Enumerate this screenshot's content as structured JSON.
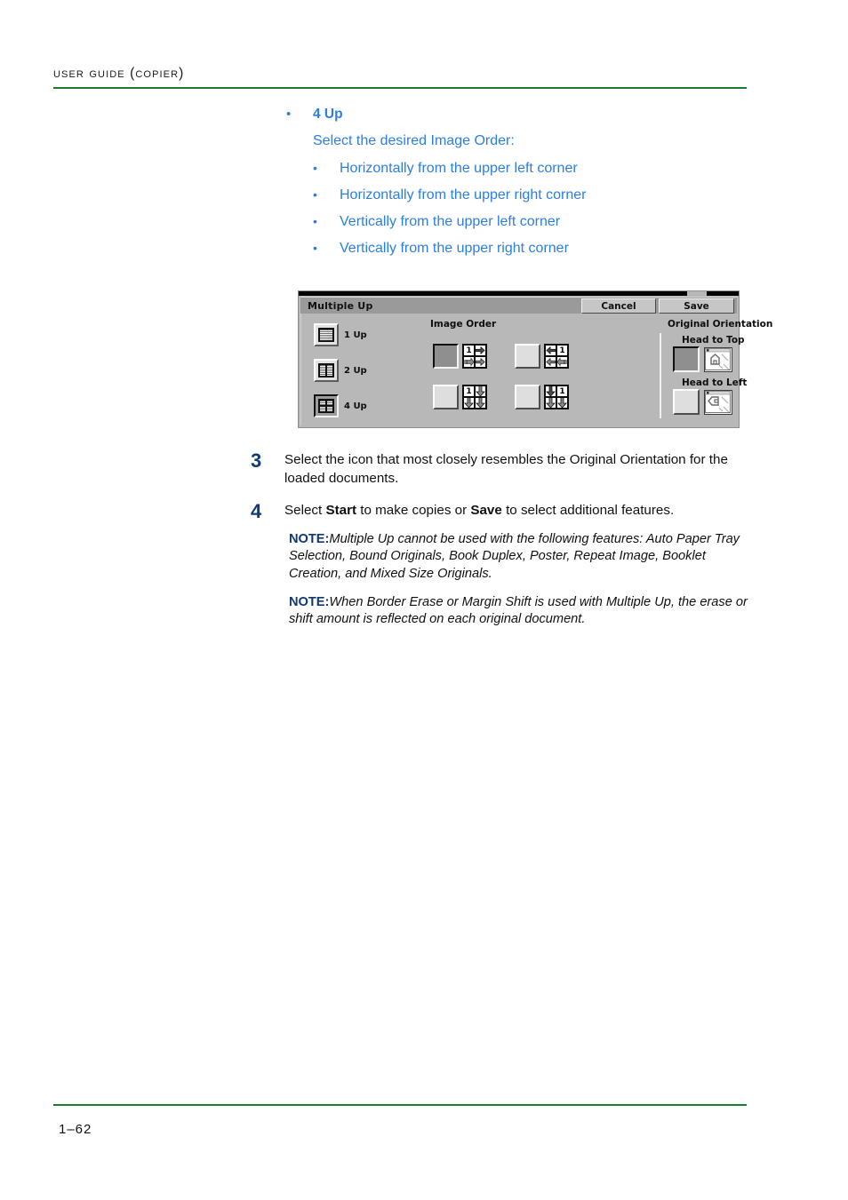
{
  "header": {
    "title": "User Guide (Copier)",
    "rule_color": "#1a7a2e"
  },
  "blue_section": {
    "accent_color": "#2c7fe0",
    "bullet_glyph": "•",
    "heading": "4 Up",
    "lead": "Select the desired Image Order:",
    "options": [
      "Horizontally from the upper left corner",
      "Horizontally from the upper right corner",
      "Vertically from the upper left corner",
      "Vertically from the upper right corner"
    ]
  },
  "copier_ui": {
    "title": "Multiple Up",
    "buttons": {
      "cancel": "Cancel",
      "save": "Save"
    },
    "up_options": [
      {
        "label": "1 Up",
        "selected": false
      },
      {
        "label": "2 Up",
        "selected": false
      },
      {
        "label": "4 Up",
        "selected": true
      }
    ],
    "image_order": {
      "heading": "Image Order",
      "cells": [
        {
          "name": "horizontal-upper-left",
          "selected": true,
          "digit": "1",
          "digit_corner": "top-left"
        },
        {
          "name": "horizontal-upper-right",
          "selected": false,
          "digit": "1",
          "digit_corner": "top-right"
        },
        {
          "name": "vertical-upper-left",
          "selected": false,
          "digit": "1",
          "digit_corner": "top-left"
        },
        {
          "name": "vertical-upper-right",
          "selected": false,
          "digit": "1",
          "digit_corner": "top-right"
        }
      ]
    },
    "original_orientation": {
      "heading": "Original Orientation",
      "options": [
        {
          "label": "Head to Top",
          "selected": true
        },
        {
          "label": "Head to Left",
          "selected": false
        }
      ]
    }
  },
  "steps": [
    {
      "number": "3",
      "text_before": "Select the icon that most closely resembles the Original Orientation for the loaded documents.",
      "bold_1": "",
      "text_mid": "",
      "bold_2": "",
      "text_after": ""
    },
    {
      "number": "4",
      "text_before": "Select ",
      "bold_1": "Start",
      "text_mid": " to make copies or ",
      "bold_2": "Save",
      "text_after": " to select additional features."
    }
  ],
  "notes": [
    {
      "label": "NOTE:",
      "text": "Multiple Up cannot be used with the following features: Auto Paper Tray Selection, Bound Originals, Book Duplex, Poster, Repeat Image, Booklet Creation, and Mixed Size Originals."
    },
    {
      "label": "NOTE:",
      "text": "When Border Erase or Margin Shift is used with Multiple Up, the erase or shift amount is reflected on each original document."
    }
  ],
  "footer": {
    "page_number": "1–62"
  }
}
